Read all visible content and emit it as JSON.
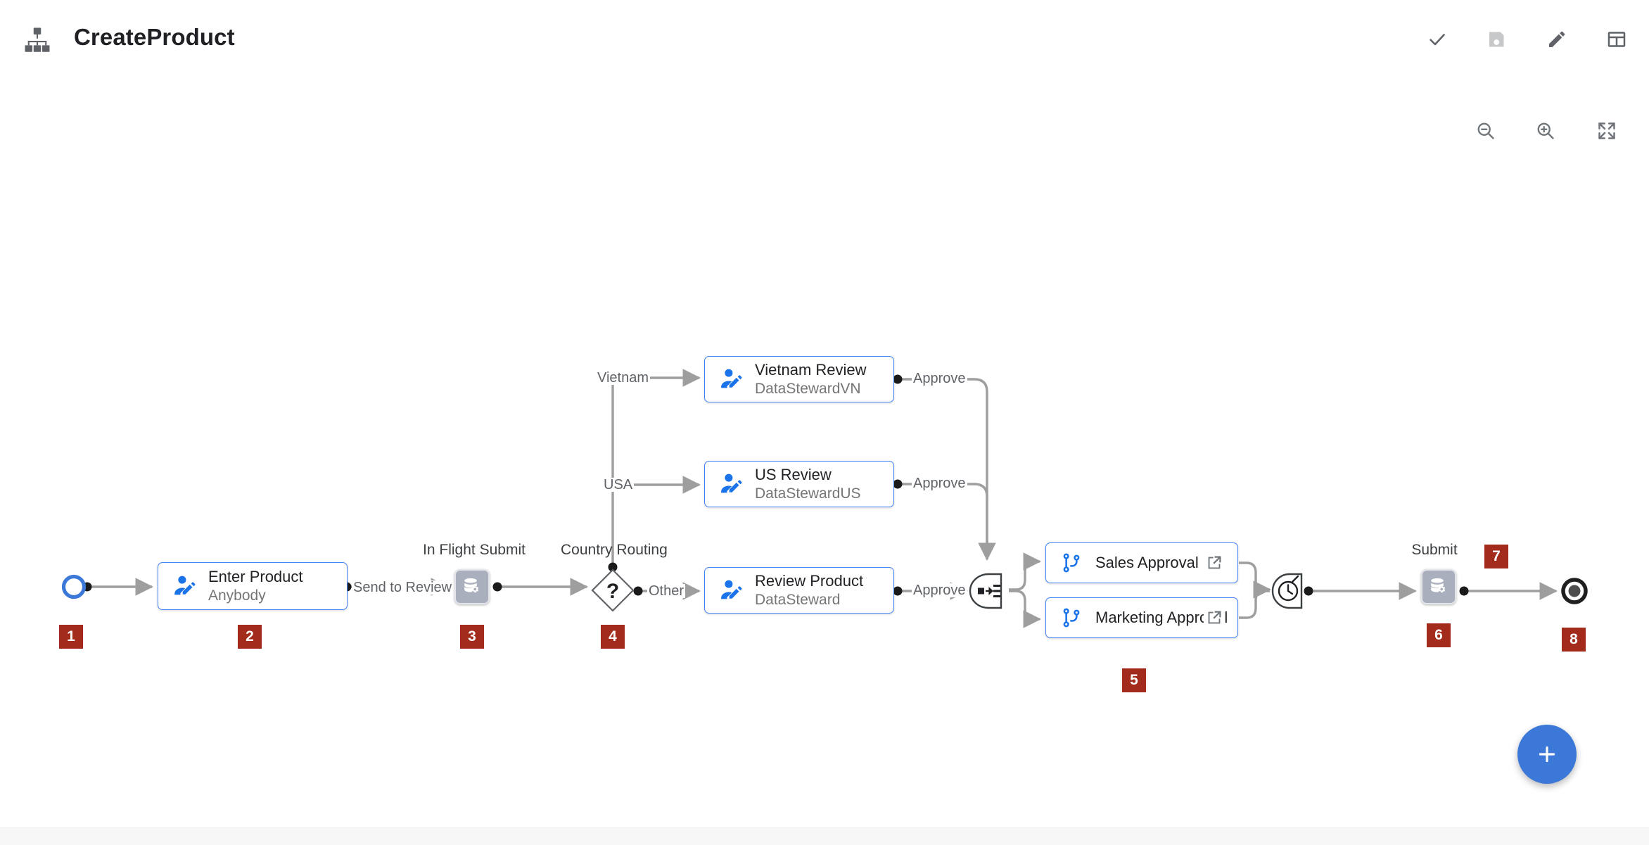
{
  "app": {
    "title": "CreateProduct",
    "icon": "hierarchy-icon"
  },
  "toolbar": {
    "items": [
      {
        "name": "validate-button",
        "icon": "check-icon",
        "label": "Validate",
        "state": "enabled"
      },
      {
        "name": "save-button",
        "icon": "save-icon",
        "label": "Save",
        "state": "disabled"
      },
      {
        "name": "edit-button",
        "icon": "pencil-icon",
        "label": "Edit",
        "state": "enabled"
      },
      {
        "name": "table-view-button",
        "icon": "table-icon",
        "label": "Table View",
        "state": "enabled"
      }
    ]
  },
  "zoom_controls": {
    "items": [
      {
        "name": "zoom-out-button",
        "icon": "magnifier-minus-icon",
        "label": "Zoom Out"
      },
      {
        "name": "zoom-in-button",
        "icon": "magnifier-plus-icon",
        "label": "Zoom In"
      },
      {
        "name": "fit-screen-button",
        "icon": "expand-arrows-icon",
        "label": "Fit to Screen"
      }
    ]
  },
  "fab": {
    "icon": "plus-icon",
    "label": "+"
  },
  "diagram": {
    "nodes": {
      "start": {
        "type": "start-event",
        "caption": ""
      },
      "enter_product": {
        "type": "user-task",
        "title": "Enter Product",
        "assignee": "Anybody",
        "icon": "user-edit-icon"
      },
      "in_flight_submit": {
        "type": "service-task",
        "caption": "In Flight Submit",
        "icon": "database-gear-icon"
      },
      "country_routing": {
        "type": "exclusive-gateway",
        "caption": "Country Routing",
        "glyph": "?"
      },
      "vietnam_review": {
        "type": "user-task",
        "title": "Vietnam Review",
        "assignee": "DataStewardVN",
        "icon": "user-edit-icon"
      },
      "us_review": {
        "type": "user-task",
        "title": "US Review",
        "assignee": "DataStewardUS",
        "icon": "user-edit-icon"
      },
      "review_product": {
        "type": "user-task",
        "title": "Review Product",
        "assignee": "DataSteward",
        "icon": "user-edit-icon"
      },
      "fork_gateway": {
        "type": "parallel-fork-gateway",
        "icon": "fork-icon"
      },
      "sales_approval": {
        "type": "subprocess-link",
        "label": "Sales Approval",
        "icon": "branch-icon",
        "action_icon": "external-link-icon"
      },
      "marketing_approval": {
        "type": "subprocess-link",
        "label": "Marketing Approval",
        "icon": "branch-icon",
        "action_icon": "external-link-icon"
      },
      "timer_join": {
        "type": "timer-join-gateway",
        "icon": "timer-icon"
      },
      "submit": {
        "type": "service-task",
        "caption": "Submit",
        "icon": "database-gear-icon"
      },
      "end": {
        "type": "end-event",
        "caption": ""
      }
    },
    "edge_labels": {
      "send_to_review": "Send to Review",
      "vietnam": "Vietnam",
      "usa": "USA",
      "other": "Other",
      "approve_vn": "Approve",
      "approve_us": "Approve",
      "approve_ds": "Approve"
    },
    "step_badges": [
      {
        "number": "1",
        "for": "start"
      },
      {
        "number": "2",
        "for": "enter_product"
      },
      {
        "number": "3",
        "for": "in_flight_submit"
      },
      {
        "number": "4",
        "for": "country_routing"
      },
      {
        "number": "5",
        "for": "approvals"
      },
      {
        "number": "6",
        "for": "submit"
      },
      {
        "number": "7",
        "for": "submit_out"
      },
      {
        "number": "8",
        "for": "end"
      }
    ]
  },
  "colors": {
    "accent_blue": "#4285f4",
    "node_icon_blue": "#1a73e8",
    "badge_red": "#a32b1c",
    "edge_gray": "#9e9e9e",
    "service_gray": "#a9afbd",
    "fab_blue": "#3b78d8",
    "text_primary": "#202124",
    "text_secondary": "#757575"
  }
}
